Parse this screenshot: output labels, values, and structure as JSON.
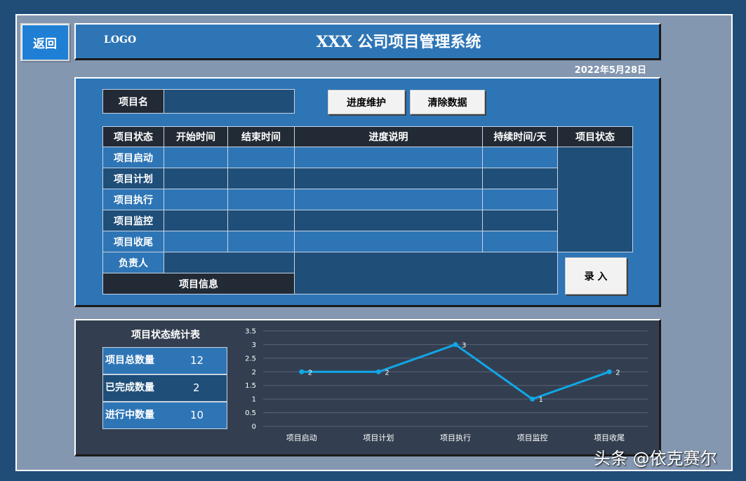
{
  "back_label": "返回",
  "header": {
    "logo": "LOGO",
    "title": "XXX 公司项目管理系统",
    "date": "2022年5月28日"
  },
  "project_name": {
    "label": "项目名",
    "value": ""
  },
  "buttons": {
    "progress": "进度维护",
    "clear": "清除数据",
    "submit": "录 入"
  },
  "table": {
    "headers": [
      "项目状态",
      "开始时间",
      "结束时间",
      "进度说明",
      "持续时间/天",
      "项目状态"
    ],
    "stages": [
      "项目启动",
      "项目计划",
      "项目执行",
      "项目监控",
      "项目收尾"
    ],
    "owner_label": "负责人",
    "owner_value": "",
    "info_label": "项目信息"
  },
  "stats": {
    "title": "项目状态统计表",
    "rows": [
      {
        "label": "项目总数量",
        "value": "12"
      },
      {
        "label": "已完成数量",
        "value": "2"
      },
      {
        "label": "进行中数量",
        "value": "10"
      }
    ]
  },
  "chart_data": {
    "type": "line",
    "categories": [
      "项目启动",
      "项目计划",
      "项目执行",
      "项目监控",
      "项目收尾"
    ],
    "series": [
      {
        "values": [
          2,
          2,
          3,
          1,
          2
        ]
      }
    ],
    "ylim": [
      0,
      3.5
    ],
    "yticks": [
      "0",
      "0.5",
      "1",
      "1.5",
      "2",
      "2.5",
      "3",
      "3.5"
    ],
    "grid": true,
    "color": "#11a7e8"
  },
  "watermark": "头条 @依克赛尔"
}
